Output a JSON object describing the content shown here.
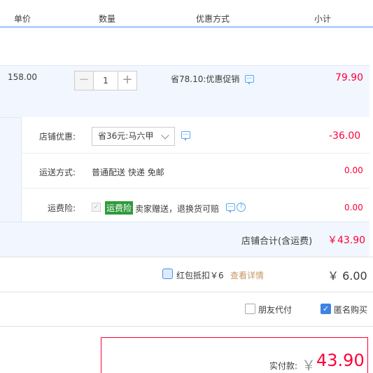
{
  "header": {
    "columns": [
      "单价",
      "数量",
      "优惠方式",
      "小计"
    ]
  },
  "item": {
    "unit_price": "158.00",
    "quantity": "1",
    "minus_label": "−",
    "plus_label": "+",
    "promo_text": "省78.10:优惠促销",
    "subtotal": "79.90"
  },
  "shop": {
    "discount_label": "店铺优惠:",
    "discount_select": "省36元:马六甲",
    "discount_amount": "-36.00",
    "shipping_label": "运送方式:",
    "shipping_value": "普通配送 快递 免邮",
    "shipping_amount": "0.00",
    "insurance_label": "运费险:",
    "insurance_badge": "运费险",
    "insurance_text": "卖家赠送，退换货可赔",
    "insurance_amount": "0.00",
    "total_label": "店铺合计(含运费)",
    "total_value": "￥43.90"
  },
  "redpack": {
    "text": "红包抵扣￥6",
    "link": "查看详情",
    "amount": "￥ 6.00"
  },
  "options": {
    "friend_pay": "朋友代付",
    "anonymous": "匿名购买",
    "anonymous_checked": true
  },
  "payment": {
    "label": "实付款:",
    "yen": "￥",
    "value": "43.90"
  },
  "colors": {
    "accent_red": "#ff0036",
    "row_bg": "#f2f7ff",
    "header_line": "#b2d1ff",
    "link_gold": "#c59764",
    "badge_green": "#2e9b3a"
  }
}
